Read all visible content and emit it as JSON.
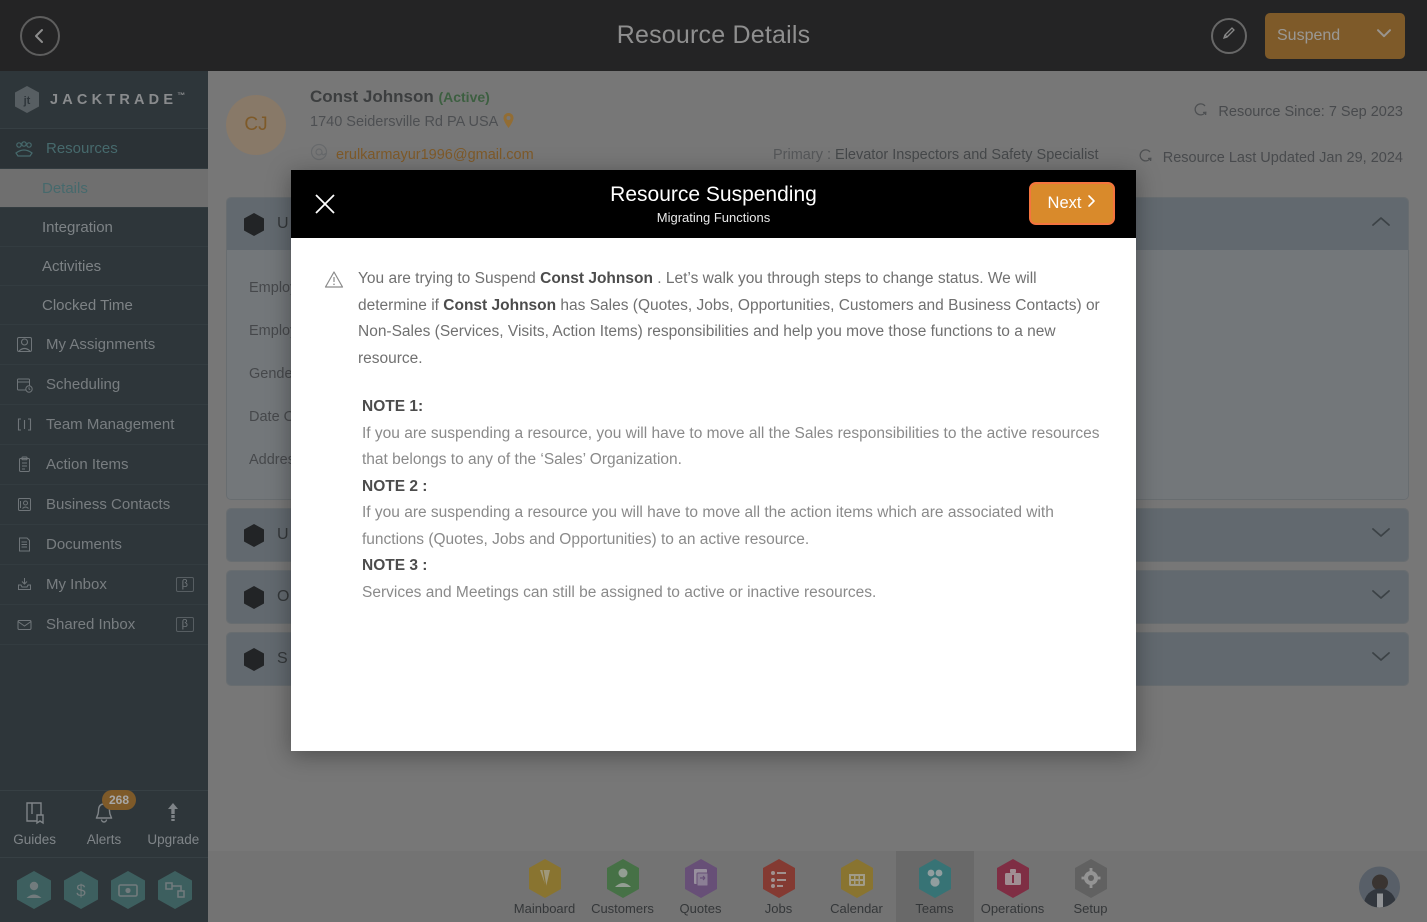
{
  "topbar": {
    "title": "Resource Details",
    "back_icon": "chevron-left-circle-icon",
    "edit_icon": "pencil-circle-icon",
    "status_select": {
      "value": "Suspend",
      "chevron": "chevron-down-icon"
    }
  },
  "brand": {
    "name": "JACKTRADE",
    "tm": "™",
    "logo_icon": "jacktrade-hex-logo"
  },
  "sidebar": {
    "group": {
      "label": "Resources",
      "icon": "resources-icon"
    },
    "subitems": [
      {
        "label": "Details",
        "active": true
      },
      {
        "label": "Integration",
        "active": false
      },
      {
        "label": "Activities",
        "active": false
      },
      {
        "label": "Clocked Time",
        "active": false
      }
    ],
    "items": [
      {
        "label": "My Assignments",
        "icon": "assignments-icon",
        "beta": ""
      },
      {
        "label": "Scheduling",
        "icon": "calendar-clock-icon",
        "beta": ""
      },
      {
        "label": "Team Management",
        "icon": "team-brackets-icon",
        "beta": ""
      },
      {
        "label": "Action Items",
        "icon": "clipboard-icon",
        "beta": ""
      },
      {
        "label": "Business Contacts",
        "icon": "contact-card-icon",
        "beta": ""
      },
      {
        "label": "Documents",
        "icon": "documents-icon",
        "beta": ""
      },
      {
        "label": "My Inbox",
        "icon": "inbox-down-icon",
        "beta": "β"
      },
      {
        "label": "Shared Inbox",
        "icon": "envelope-icon",
        "beta": "β"
      }
    ],
    "tools": [
      {
        "label": "Guides",
        "icon": "book-icon",
        "badge": ""
      },
      {
        "label": "Alerts",
        "icon": "bell-icon",
        "badge": "268"
      },
      {
        "label": "Upgrade",
        "icon": "upgrade-arrow-icon",
        "badge": ""
      }
    ],
    "quick_hex": [
      {
        "name": "person-hex-button"
      },
      {
        "name": "dollar-hex-button"
      },
      {
        "name": "payment-hex-button"
      },
      {
        "name": "workflow-hex-button"
      }
    ]
  },
  "resource": {
    "initials": "CJ",
    "name": "Const Johnson",
    "status": "(Active)",
    "address": "1740 Seidersville Rd PA USA",
    "location_icon": "map-pin-icon",
    "email_icon": "at-icon",
    "email": "erulkarmayur1996@gmail.com",
    "primary_key": "Primary :",
    "primary_value": "Elevator Inspectors and Safety Specialist",
    "since": "Resource Since: 7 Sep 2023",
    "last_updated": "Resource Last Updated Jan 29, 2024",
    "refresh_icon": "refresh-arrow-icon"
  },
  "accordions": [
    {
      "title": "U",
      "expanded": true,
      "chevron": "chevron-up-icon",
      "fields": [
        "Employe",
        "Employe",
        "Gender",
        "Date Of",
        "Address"
      ]
    },
    {
      "title": "U",
      "expanded": false,
      "chevron": "chevron-down-icon",
      "fields": []
    },
    {
      "title": "O",
      "expanded": false,
      "chevron": "chevron-down-icon",
      "fields": []
    },
    {
      "title": "S",
      "expanded": false,
      "chevron": "chevron-down-icon",
      "fields": []
    }
  ],
  "modal": {
    "close_icon": "close-x-icon",
    "title": "Resource Suspending",
    "subtitle": "Migrating Functions",
    "next_label": "Next",
    "next_chevron": "chevron-right-icon",
    "warning_icon": "warning-triangle-icon",
    "intro_1": "You are trying to Suspend ",
    "intro_name_1": "Const Johnson",
    "intro_2": " . Let’s walk you through steps to change status. We will determine if ",
    "intro_name_2": "Const Johnson",
    "intro_3": " has Sales (Quotes, Jobs, Opportunities, Customers and Business Contacts) or Non-Sales (Services, Visits, Action Items) responsibilities and help you move those functions to a new resource.",
    "notes": [
      {
        "heading": "NOTE 1:",
        "text": "If you are suspending a resource, you will have to move all the Sales responsibilities to the active resources that belongs to any of the ‘Sales’ Organization."
      },
      {
        "heading": "NOTE 2 :",
        "text": "If you are suspending a resource you will have to move all the action items which are associated with functions (Quotes, Jobs and Opportunities) to an active resource."
      },
      {
        "heading": "NOTE 3 :",
        "text": "Services and Meetings can still be assigned to active or inactive resources."
      }
    ]
  },
  "bottomnav": {
    "items": [
      {
        "label": "Mainboard",
        "icon": "mainboard-icon",
        "color": "#c9a227",
        "selected": false
      },
      {
        "label": "Customers",
        "icon": "customers-icon",
        "color": "#4f9d4f",
        "selected": false
      },
      {
        "label": "Quotes",
        "icon": "quotes-icon",
        "color": "#8b5fa8",
        "selected": false
      },
      {
        "label": "Jobs",
        "icon": "jobs-icon",
        "color": "#c0392b",
        "selected": false
      },
      {
        "label": "Calendar",
        "icon": "calendar-icon",
        "color": "#c9a227",
        "selected": false
      },
      {
        "label": "Teams",
        "icon": "teams-icon",
        "color": "#34a0a4",
        "selected": true
      },
      {
        "label": "Operations",
        "icon": "operations-icon",
        "color": "#b7244c",
        "selected": false
      },
      {
        "label": "Setup",
        "icon": "setup-gear-icon",
        "color": "#808080",
        "selected": false
      }
    ],
    "avatar": "user-avatar"
  },
  "colors": {
    "accent_orange": "#b5731a",
    "brand_teal": "#4f8f94",
    "sidebar_bg": "#243239",
    "topbar_bg": "#111113",
    "next_button": "#d98a2b",
    "next_border": "#f4743e"
  }
}
